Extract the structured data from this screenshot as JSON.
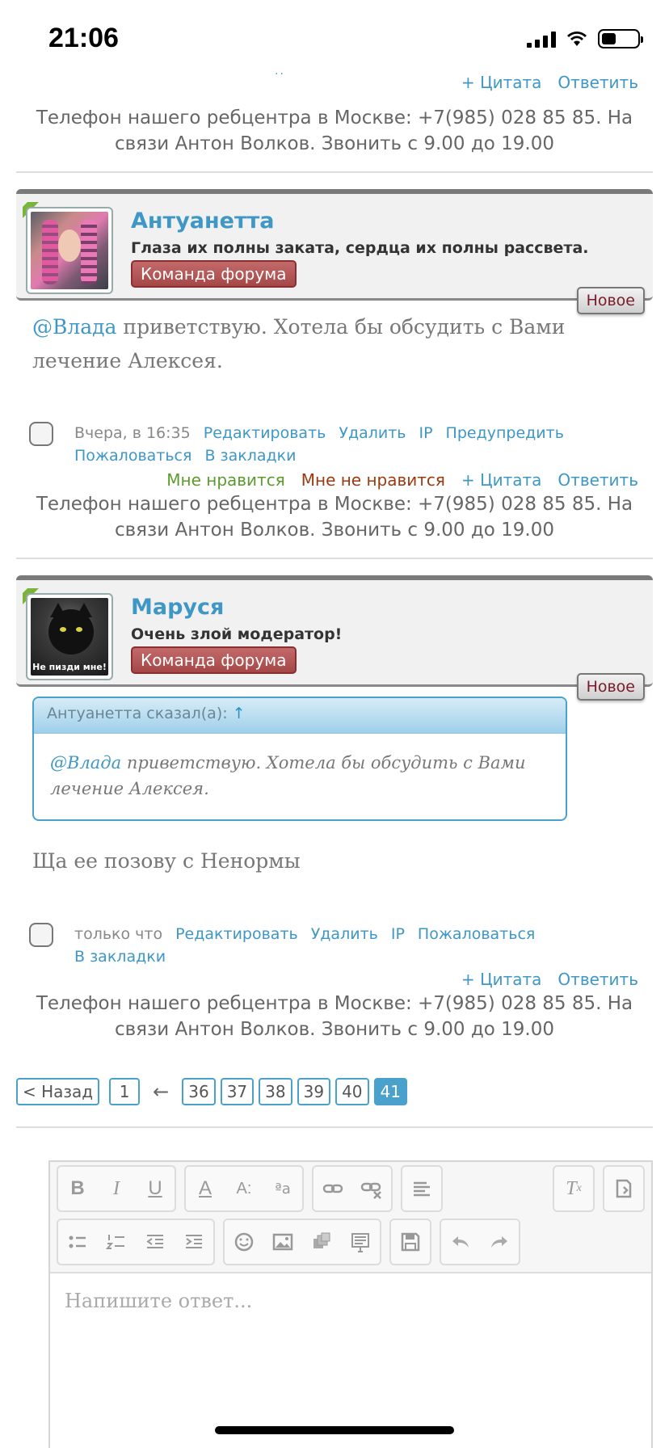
{
  "status_bar": {
    "time": "21:06"
  },
  "top_dots": "··",
  "actions": {
    "quote": "+ Цитата",
    "reply": "Ответить",
    "like": "Мне нравится",
    "dislike": "Мне не нравится"
  },
  "signature": "Телефон нашего ребцентра в Москве: +7(985) 028 85 85. На связи Антон Волков. Звонить с 9.00 до 19.00",
  "posts": [
    {
      "user": {
        "name": "Антуанетта",
        "title": "Глаза их полны заката, сердца их полны рассвета.",
        "badge": "Команда форума"
      },
      "new_label": "Новое",
      "mention": "@Влада",
      "text": " приветствую. Хотела бы обсудить с Вами лечение Алексея.",
      "date": "Вчера, в 16:35",
      "links": [
        "Редактировать",
        "Удалить",
        "IP",
        "Предупредить",
        "Пожаловаться",
        "В закладки"
      ]
    },
    {
      "user": {
        "name": "Маруся",
        "title": "Очень злой модератор!",
        "badge": "Команда форума",
        "avatar_caption": "Не пизди мне!"
      },
      "new_label": "Новое",
      "quote": {
        "author": "Антуанетта сказал(а):",
        "arrow": "↑",
        "mention": "@Влада",
        "text": " приветствую. Хотела бы обсудить с Вами лечение Алексея."
      },
      "text": "Ща ее позову с Ненормы",
      "date": "только что",
      "links": [
        "Редактировать",
        "Удалить",
        "IP",
        "Пожаловаться",
        "В закладки"
      ]
    }
  ],
  "pagination": {
    "back": "< Назад",
    "first": "1",
    "gap": "←",
    "pages": [
      "36",
      "37",
      "38",
      "39",
      "40",
      "41"
    ],
    "current": "41"
  },
  "editor": {
    "placeholder": "Напишите ответ..."
  },
  "colors": {
    "link": "#3e97c5",
    "badge": "#a54747",
    "like": "#5c9a2e",
    "dislike": "#9b3a0f"
  }
}
